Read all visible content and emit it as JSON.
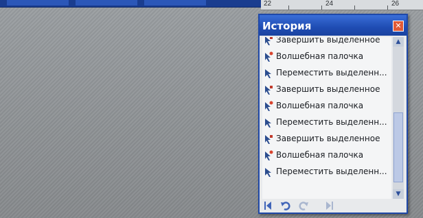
{
  "panel": {
    "title": "История",
    "close_glyph": "✕",
    "items": [
      {
        "label": "Завершить выделенное",
        "icon": "finish-selection-icon"
      },
      {
        "label": "Волшебная палочка",
        "icon": "magic-wand-icon"
      },
      {
        "label": "Переместить выделенн...",
        "icon": "move-selection-icon"
      },
      {
        "label": "Завершить выделенное",
        "icon": "finish-selection-icon"
      },
      {
        "label": "Волшебная палочка",
        "icon": "magic-wand-icon"
      },
      {
        "label": "Переместить выделенн...",
        "icon": "move-selection-icon"
      },
      {
        "label": "Завершить выделенное",
        "icon": "finish-selection-icon"
      },
      {
        "label": "Волшебная палочка",
        "icon": "magic-wand-icon"
      },
      {
        "label": "Переместить выделенн...",
        "icon": "move-selection-icon"
      }
    ],
    "toolbar_icons": [
      "first-icon",
      "undo-icon",
      "redo-icon",
      "last-icon"
    ]
  },
  "ruler": {
    "labels": [
      "22",
      "24",
      "26"
    ]
  },
  "colors": {
    "title_bar": "#1f4cb3",
    "panel_bg": "#e8eaec",
    "canvas": "#8f9396"
  }
}
